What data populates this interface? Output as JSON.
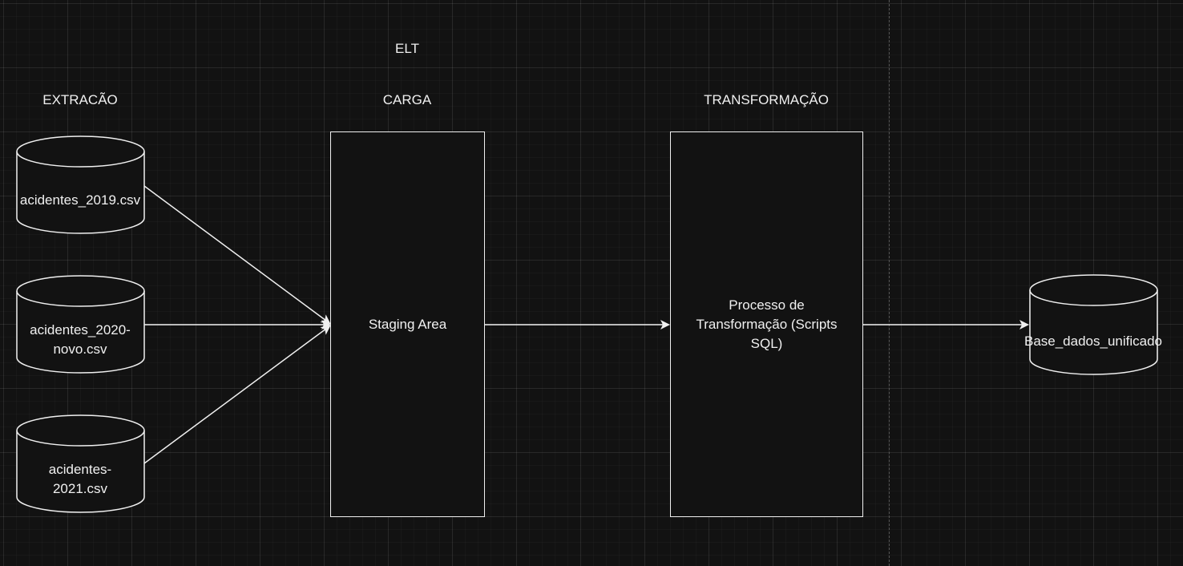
{
  "diagram": {
    "title": "ELT",
    "stages": {
      "extract": "EXTRACÃO",
      "load": "CARGA",
      "transform": "TRANSFORMAÇÃO"
    },
    "sources": [
      {
        "line1": "acidentes_2019.csv",
        "line2": ""
      },
      {
        "line1": "acidentes_2020-",
        "line2": "novo.csv"
      },
      {
        "line1": "acidentes-",
        "line2": "2021.csv"
      }
    ],
    "staging": {
      "label": "Staging Area"
    },
    "process": {
      "line1": "Processo de",
      "line2": "Transformação (Scripts",
      "line3": "SQL)"
    },
    "output": {
      "label": "Base_dados_unificado"
    },
    "colors": {
      "background": "#121212",
      "stroke": "#f0f0f0",
      "text": "#f0f0f0",
      "grid": "#2a2a2a"
    }
  }
}
